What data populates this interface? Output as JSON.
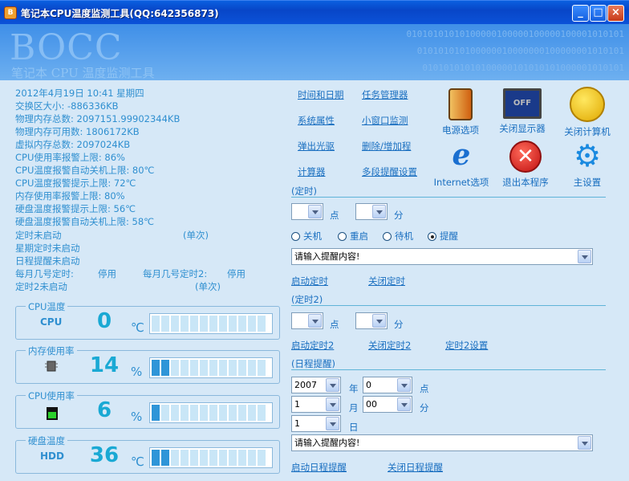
{
  "window": {
    "title": "笔记本CPU温度监测工具(QQ:642356873)",
    "minimize": "_",
    "maximize": "□",
    "close": "×"
  },
  "banner": {
    "logo": "BOCC",
    "subtitle": "笔记本 CPU 温度监测工具",
    "binary1": "01010101010100000100000100000100001010101",
    "binary2": "010101010100000010000000100000001010101",
    "binary3": "01010101010100000101010101000001010101"
  },
  "info": [
    "2012年4月19日 10:41 星期四",
    "交换区大小: -886336KB",
    "物理内存总数: 2097151.99902344KB",
    "物理内存可用数: 1806172KB",
    "虚拟内存总数: 2097024KB",
    "CPU使用率报警上限: 86%",
    "CPU温度报警自动关机上限: 80℃",
    "CPU温度报警提示上限: 72℃",
    "内存使用率报警上限: 80%",
    "硬盘温度报警提示上限: 56℃",
    "硬盘温度报警自动关机上限: 58℃"
  ],
  "status": {
    "timer": "定时未启动",
    "timer_once": "(单次)",
    "week": "星期定时未启动",
    "schedule": "日程提醒未启动",
    "monthly": "每月几号定时:",
    "monthly_val": "停用",
    "monthly2": "每月几号定时2:",
    "monthly2_val": "停用",
    "timer2": "定时2未启动",
    "timer2_once": "(单次)"
  },
  "gauges": [
    {
      "label": "CPU温度",
      "icon": "CPU",
      "value": "0",
      "unit": "℃",
      "level": 0
    },
    {
      "label": "内存使用率",
      "icon": "memory-chip-icon",
      "value": "14",
      "unit": "%",
      "level": 0.14
    },
    {
      "label": "CPU使用率",
      "icon": "cpu-usage-icon",
      "value": "6",
      "unit": "%",
      "level": 0.06
    },
    {
      "label": "硬盘温度",
      "icon": "HDD",
      "value": "36",
      "unit": "℃",
      "level": 0.2
    }
  ],
  "links": {
    "datetime": "时间和日期",
    "taskmgr": "任务管理器",
    "sysprop": "系统属性",
    "miniwin": "小窗口监测",
    "eject": "弹出光驱",
    "addremove": "删除/增加程",
    "calc": "计算器",
    "multi": "多段提醒设置"
  },
  "icons": {
    "power": "电源选项",
    "display": "关闭显示器",
    "shutdown": "关闭计算机",
    "internet": "Internet选项",
    "exit": "退出本程序",
    "settings": "主设置",
    "display_text": "OFF"
  },
  "timer1": {
    "title": "(定时)",
    "hour_label": "点",
    "min_label": "分",
    "options": [
      "关机",
      "重启",
      "待机",
      "提醒"
    ],
    "selected": 3,
    "message": "请输入提醒内容!",
    "start": "启动定时",
    "stop": "关闭定时"
  },
  "timer2": {
    "title": "(定时2)",
    "hour_label": "点",
    "min_label": "分",
    "start": "启动定时2",
    "stop": "关闭定时2",
    "setup": "定时2设置"
  },
  "schedule": {
    "title": "(日程提醒)",
    "year": "2007",
    "year_label": "年",
    "hour": "0",
    "hour_label": "点",
    "month": "1",
    "month_label": "月",
    "minute": "00",
    "min_label": "分",
    "day": "1",
    "day_label": "日",
    "message": "请输入提醒内容!",
    "start": "启动日程提醒",
    "stop": "关闭日程提醒"
  }
}
